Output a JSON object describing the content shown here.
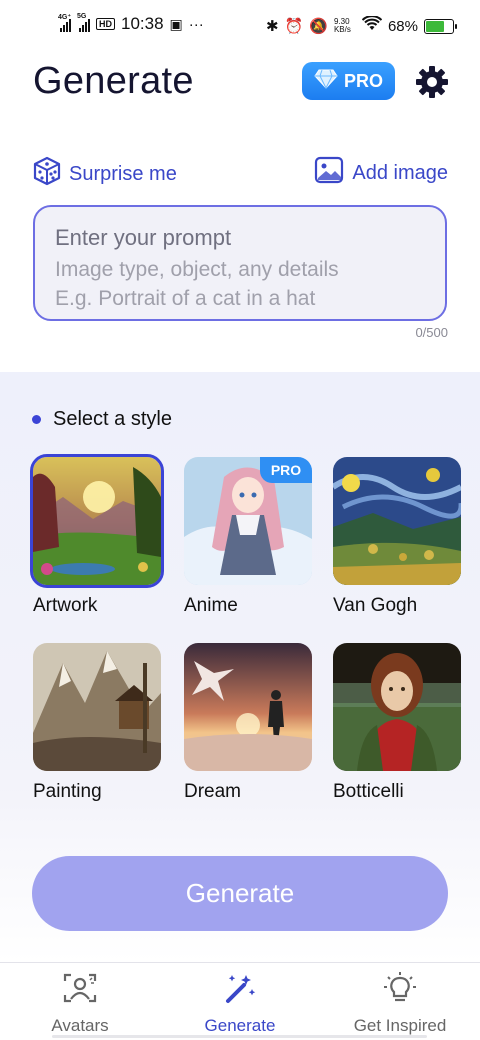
{
  "status_bar": {
    "net1": "4G⁺",
    "net2": "5G",
    "hd": "HD",
    "time": "10:38",
    "speed": "9.30 KB/s",
    "battery_text": "68%",
    "battery_level": 0.68
  },
  "header": {
    "title": "Generate",
    "pro_label": "PRO",
    "settings_icon": "gear-icon"
  },
  "actions": {
    "surprise_label": "Surprise me",
    "add_image_label": "Add image"
  },
  "prompt": {
    "title": "Enter your prompt",
    "hint_line1": "Image type, object, any details",
    "hint_line2": "E.g. Portrait of a cat in a hat",
    "counter": "0/500"
  },
  "styles": {
    "heading": "Select a style",
    "items": [
      {
        "label": "Artwork",
        "selected": true
      },
      {
        "label": "Anime",
        "badge": "PRO"
      },
      {
        "label": "Van Gogh"
      },
      {
        "label": "Painting"
      },
      {
        "label": "Dream"
      },
      {
        "label": "Botticelli"
      }
    ]
  },
  "generate_button": "Generate",
  "bottom_nav": [
    {
      "label": "Avatars",
      "icon": "avatar-scan-icon"
    },
    {
      "label": "Generate",
      "icon": "magic-wand-icon",
      "active": true
    },
    {
      "label": "Get Inspired",
      "icon": "lightbulb-icon"
    }
  ],
  "colors": {
    "accent": "#3a47c8",
    "pro_blue": "#2f8ff3",
    "generate_disabled": "#a1a3ef"
  }
}
